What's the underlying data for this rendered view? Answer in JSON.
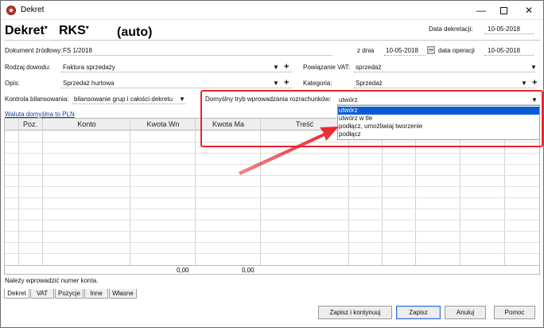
{
  "window": {
    "title": "Dekret",
    "controls": {
      "minimize": "—",
      "close": "✕"
    }
  },
  "header": {
    "doc_type": "Dekret",
    "register": "RKS",
    "auto_label": "(auto)",
    "decree_date_label": "Data dekretacji:",
    "decree_date": "10-05-2018"
  },
  "form": {
    "source_doc_label": "Dokument źródłowy:",
    "source_doc": "FS 1/2018",
    "date_label": "z dnia",
    "date": "10-05-2018",
    "operation_date_label": "data operacji",
    "operation_date": "10-05-2018",
    "proof_kind_label": "Rodzaj dowodu:",
    "proof_kind": "Faktura sprzedaży",
    "vat_link_label": "Powiązanie VAT:",
    "vat_link": "sprzedaż",
    "description_label": "Opis:",
    "description": "Sprzedaż hurtowa",
    "category_label": "Kategoria:",
    "category": "Sprzedaż",
    "balance_control_label": "Kontrola bilansowania:",
    "balance_control": "bilansowanie grup i całości dekretu",
    "settlement_mode_label": "Domyślny tryb wprowadzania rozrachunków:",
    "settlement_mode": "utwórz",
    "currency_link": "Waluta domyślna to PLN"
  },
  "dropdown": {
    "options": [
      "utwórz",
      "utwórz w tle",
      "podłącz, umożliwiaj tworzenie",
      "podłącz"
    ],
    "selected_index": 0
  },
  "grid": {
    "columns": [
      "Poz.",
      "Konto",
      "Kwota Wn",
      "Kwota Ma",
      "Treść"
    ],
    "sum_wn": "0,00",
    "sum_ma": "0,00"
  },
  "status_message": "Należy wprowadzić numer konta.",
  "tabs": [
    "Dekret",
    "VAT",
    "Pozycje",
    "Inne",
    "Własne"
  ],
  "buttons": {
    "save_continue": "Zapisz i kontynuuj",
    "save": "Zapisz",
    "cancel": "Anuluj",
    "help": "Pomoc"
  },
  "colors": {
    "highlight": "#e8232a",
    "selection": "#0b5cd5"
  }
}
